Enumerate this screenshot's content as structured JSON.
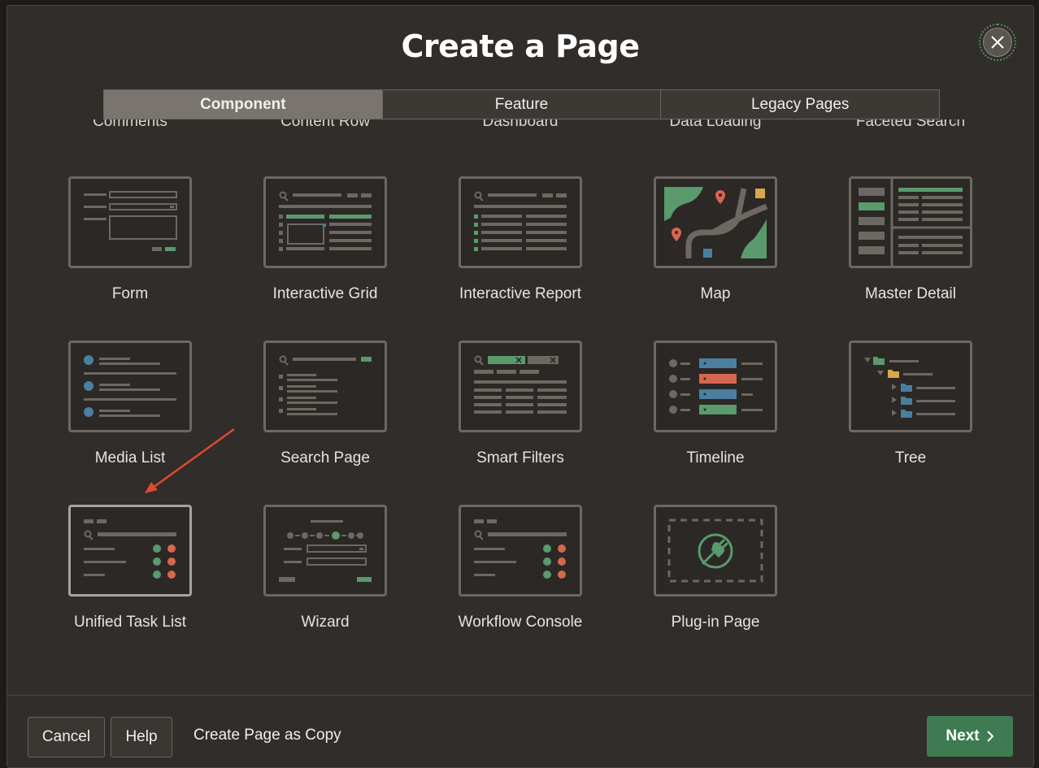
{
  "dialog": {
    "title": "Create a Page"
  },
  "tabs": [
    {
      "label": "Component",
      "active": true
    },
    {
      "label": "Feature",
      "active": false
    },
    {
      "label": "Legacy Pages",
      "active": false
    }
  ],
  "partial_row": [
    "Comments",
    "Content Row",
    "Dashboard",
    "Data Loading",
    "Faceted Search"
  ],
  "cards": [
    {
      "label": "Form",
      "icon": "form-icon"
    },
    {
      "label": "Interactive Grid",
      "icon": "interactive-grid-icon"
    },
    {
      "label": "Interactive Report",
      "icon": "interactive-report-icon"
    },
    {
      "label": "Map",
      "icon": "map-icon"
    },
    {
      "label": "Master Detail",
      "icon": "master-detail-icon"
    },
    {
      "label": "Media List",
      "icon": "media-list-icon"
    },
    {
      "label": "Search Page",
      "icon": "search-page-icon"
    },
    {
      "label": "Smart Filters",
      "icon": "smart-filters-icon"
    },
    {
      "label": "Timeline",
      "icon": "timeline-icon"
    },
    {
      "label": "Tree",
      "icon": "tree-icon"
    },
    {
      "label": "Unified Task List",
      "icon": "unified-task-list-icon",
      "selected": true
    },
    {
      "label": "Wizard",
      "icon": "wizard-icon"
    },
    {
      "label": "Workflow Console",
      "icon": "workflow-console-icon"
    },
    {
      "label": "Plug-in Page",
      "icon": "plug-in-icon"
    }
  ],
  "footer": {
    "cancel": "Cancel",
    "help": "Help",
    "copy_link": "Create Page as Copy",
    "next": "Next"
  },
  "colors": {
    "accent_green": "#5a9a6c",
    "accent_red": "#d6664f",
    "accent_blue": "#4a7fa0",
    "annotation_arrow": "#e04a30"
  }
}
